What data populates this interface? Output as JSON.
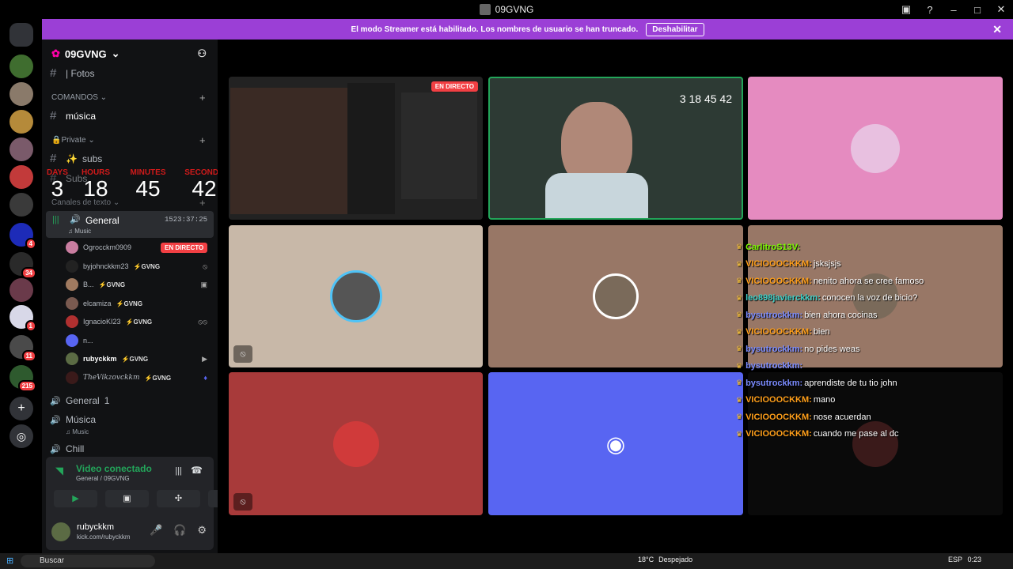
{
  "window": {
    "title": "09GVNG",
    "controls": [
      "help",
      "minimize",
      "maximize",
      "close"
    ]
  },
  "banner": {
    "message": "El modo Streamer está habilitado. Los nombres de usuario se han truncado.",
    "button": "Deshabilitar"
  },
  "servers": [
    {
      "badge": ""
    },
    {
      "badge": ""
    },
    {
      "badge": ""
    },
    {
      "badge": ""
    },
    {
      "badge": ""
    },
    {
      "badge": ""
    },
    {
      "badge": "4"
    },
    {
      "badge": "34"
    },
    {
      "badge": ""
    },
    {
      "badge": "1"
    },
    {
      "badge": "11"
    },
    {
      "badge": "215"
    }
  ],
  "sidebar": {
    "server_name": "09GVNG",
    "channel_fotos": "| Fotos",
    "category_comandos": "COMANDOS",
    "channel_musica_text": "música",
    "category_private": "Private",
    "channel_subs": "subs",
    "channel_subs2": "Subs",
    "category_texto": "Canales de texto",
    "countdown": {
      "days_label": "DAYS",
      "days": "3",
      "hours_label": "HOURS",
      "hours": "18",
      "minutes_label": "MINUTES",
      "minutes": "45",
      "seconds_label": "SECONDS",
      "seconds": "42"
    },
    "voice_general": {
      "name": "General",
      "sub": "Music",
      "time": "1523:37:25"
    },
    "members": [
      {
        "name": "Ogrocckm0909",
        "tag": "",
        "live": "EN DIRECTO"
      },
      {
        "name": "byjohnckkm23",
        "tag": "GVNG",
        "live": ""
      },
      {
        "name": "B...",
        "tag": "GVNG",
        "live": ""
      },
      {
        "name": "elcamiza",
        "tag": "GVNG",
        "live": ""
      },
      {
        "name": "IgnacioKI23",
        "tag": "GVNG",
        "live": ""
      },
      {
        "name": "n...",
        "tag": "",
        "live": ""
      },
      {
        "name": "rubyckkm",
        "tag": "GVNG",
        "live": ""
      },
      {
        "name": "TheVikzovckkm",
        "tag": "GVNG",
        "live": ""
      }
    ],
    "voice_general1": "General",
    "voice_musica": "Música",
    "voice_musica_sub": "Music",
    "voice_chill": "Chill"
  },
  "voice_panel": {
    "status": "Video conectado",
    "sub": "General / 09GVNG"
  },
  "user": {
    "name": "rubyckkm",
    "status": "kick.com/rubyckkm"
  },
  "stream_tile": {
    "live_badge": "EN DIRECTO"
  },
  "chat": [
    {
      "name": "CarlitroS13V:",
      "text": "",
      "color": "#7cfc00"
    },
    {
      "name": "VICIOOOCKKM:",
      "text": "jsksjsjs",
      "color": "#ff9f1a"
    },
    {
      "name": "VICIOOOCKKM:",
      "text": "nenito ahora se cree famoso",
      "color": "#ff9f1a"
    },
    {
      "name": "leo898javierckkm:",
      "text": "conocen la voz de bicio?",
      "color": "#3fd0c8"
    },
    {
      "name": "bysutrockkm:",
      "text": "bien ahora cocinas",
      "color": "#7b8cff"
    },
    {
      "name": "VICIOOOCKKM:",
      "text": "bien",
      "color": "#ff9f1a"
    },
    {
      "name": "bysutrockkm:",
      "text": "no pides weas",
      "color": "#7b8cff"
    },
    {
      "name": "bysutrockkm:",
      "text": "",
      "color": "#7b8cff"
    },
    {
      "name": "bysutrockkm:",
      "text": "aprendiste de tu tio john",
      "color": "#7b8cff"
    },
    {
      "name": "VICIOOOCKKM:",
      "text": "mano",
      "color": "#ff9f1a"
    },
    {
      "name": "VICIOOOCKKM:",
      "text": "nose acuerdan",
      "color": "#ff9f1a"
    },
    {
      "name": "VICIOOOCKKM:",
      "text": "cuando me pase al dc",
      "color": "#ff9f1a"
    }
  ],
  "taskbar": {
    "search": "Buscar",
    "weather_temp": "18°C",
    "weather_text": "Despejado",
    "lang": "ESP",
    "time": "0:23"
  },
  "colors": {
    "accent": "#9b3fd6",
    "live": "#f23f43",
    "connected": "#23a55a",
    "discord_blurple": "#5865f2"
  }
}
